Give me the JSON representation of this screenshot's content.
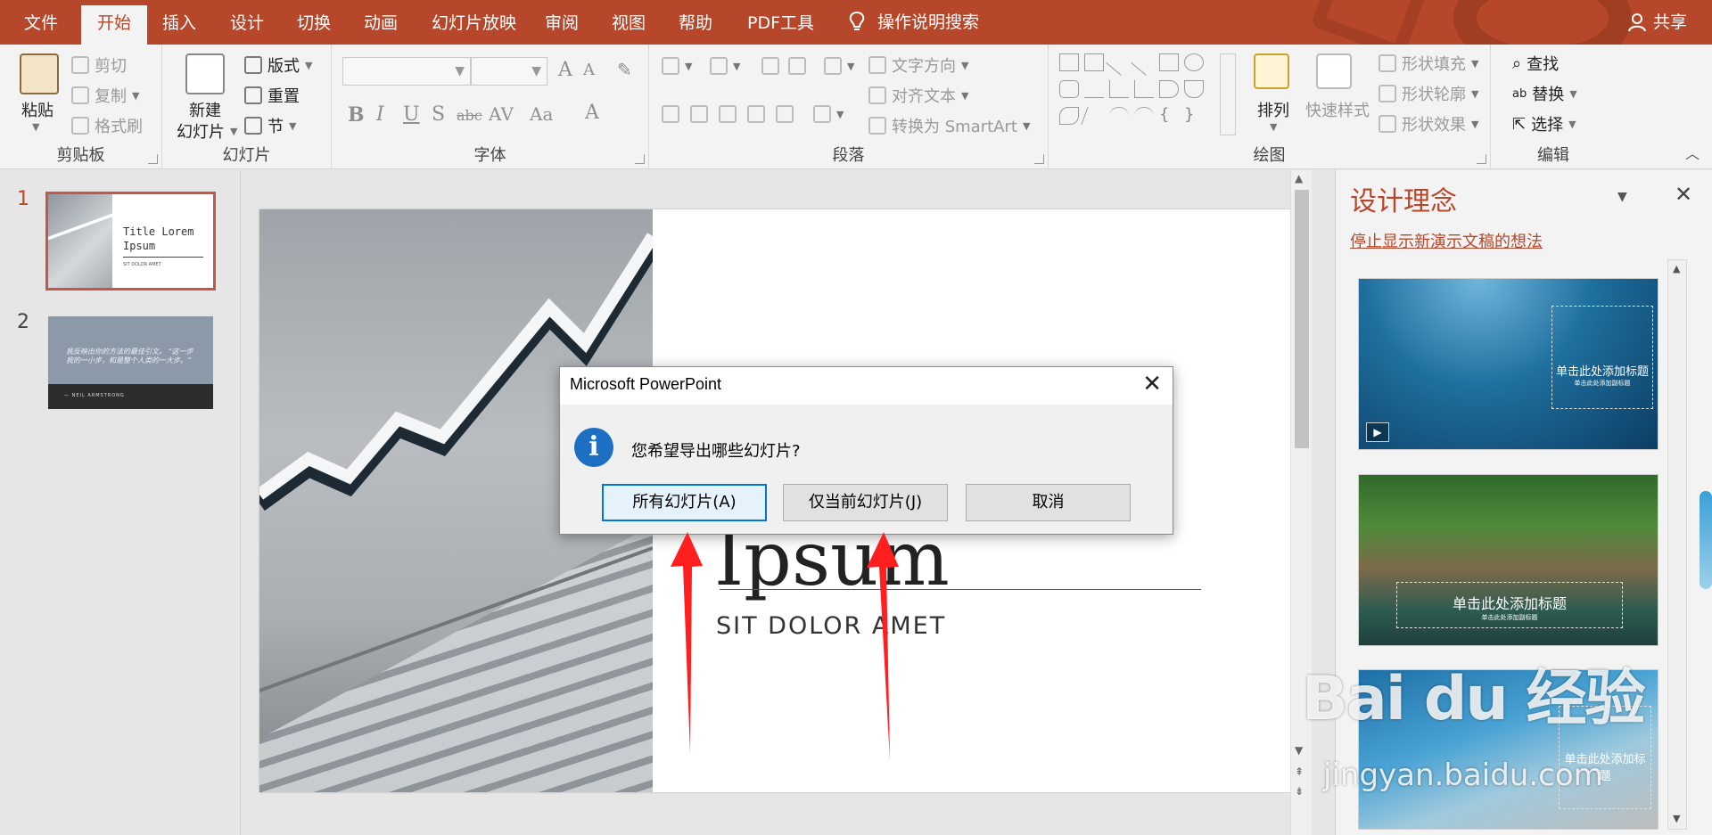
{
  "tabs": [
    {
      "label": "文件",
      "active": false
    },
    {
      "label": "开始",
      "active": true
    },
    {
      "label": "插入",
      "active": false
    },
    {
      "label": "设计",
      "active": false
    },
    {
      "label": "切换",
      "active": false
    },
    {
      "label": "动画",
      "active": false
    },
    {
      "label": "幻灯片放映",
      "active": false
    },
    {
      "label": "审阅",
      "active": false
    },
    {
      "label": "视图",
      "active": false
    },
    {
      "label": "帮助",
      "active": false
    },
    {
      "label": "PDF工具",
      "active": false
    }
  ],
  "tell_me": {
    "label": "操作说明搜索",
    "icon": "lightbulb-icon"
  },
  "share": {
    "label": "共享",
    "icon": "person-icon"
  },
  "ribbon": {
    "clipboard": {
      "paste": "粘贴",
      "cut": "剪切",
      "copy": "复制",
      "format_painter": "格式刷",
      "label": "剪贴板"
    },
    "slides": {
      "new_slide": "新建",
      "new_slide_2": "幻灯片",
      "layout": "版式",
      "reset": "重置",
      "section": "节",
      "label": "幻灯片"
    },
    "font": {
      "bold": "B",
      "italic": "I",
      "underline": "U",
      "shadow": "S",
      "strike": "abc",
      "spacing": "AV",
      "case": "Aa",
      "color": "A",
      "label": "字体"
    },
    "paragraph": {
      "text_direction": "文字方向",
      "align_text": "对齐文本",
      "smartart": "转换为 SmartArt",
      "label": "段落"
    },
    "drawing": {
      "arrange": "排列",
      "quick_styles": "快速样式",
      "shape_fill": "形状填充",
      "shape_outline": "形状轮廓",
      "shape_effects": "形状效果",
      "label": "绘图"
    },
    "editing": {
      "find": "查找",
      "replace": "替换",
      "select": "选择",
      "label": "编辑"
    }
  },
  "thumbnails": [
    {
      "num": "1",
      "title": "Title Lorem Ipsum",
      "subtitle": "SIT DOLOR AMET"
    },
    {
      "num": "2",
      "quote": "我反映出你的方法的最佳引文。 “这一步我的一小步，和是整个人类的一大步。”",
      "author": "— NEIL ARMSTRONG"
    }
  ],
  "slide": {
    "title": "Title Lorem Ipsum",
    "subtitle": "SIT DOLOR AMET"
  },
  "design_pane": {
    "title": "设计理念",
    "link": "停止显示新演示文稿的想法",
    "items": [
      {
        "title": "单击此处添加标题",
        "subtitle": "单击此处添加副标题"
      },
      {
        "title": "单击此处添加标题",
        "subtitle": "单击此处添加副标题"
      },
      {
        "title": "单击此处添加标题",
        "subtitle": ""
      }
    ]
  },
  "dialog": {
    "title": "Microsoft PowerPoint",
    "message": "您希望导出哪些幻灯片?",
    "buttons": {
      "all": "所有幻灯片(A)",
      "current": "仅当前幻灯片(J)",
      "cancel": "取消"
    }
  },
  "watermark": {
    "brand": "Bai du 经验",
    "url": "jingyan.baidu.com"
  },
  "colors": {
    "accent": "#b7472a",
    "dialog_default": "#0078d7",
    "arrow": "#ff1f1f"
  }
}
